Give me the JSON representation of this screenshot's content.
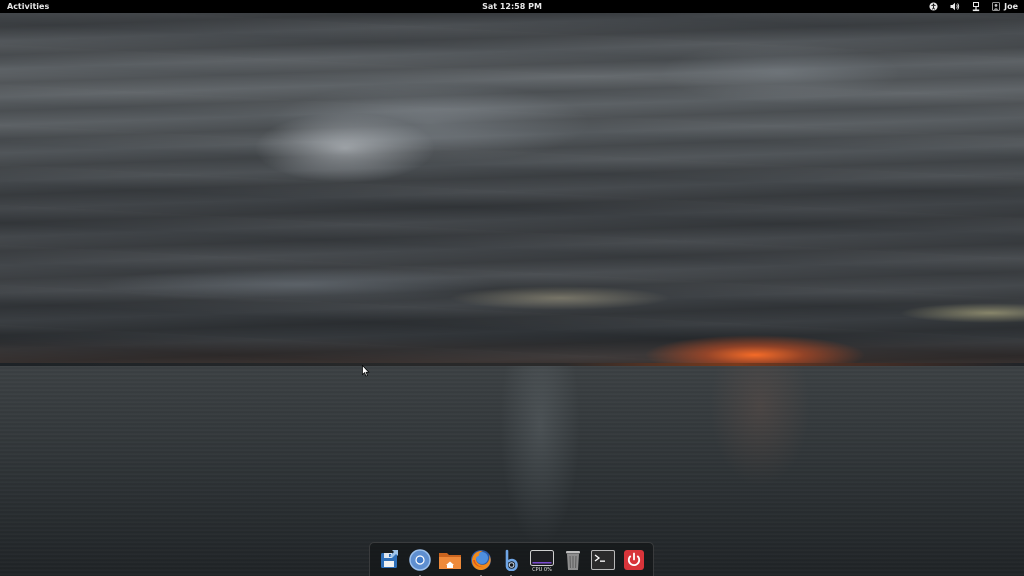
{
  "topbar": {
    "activities_label": "Activities",
    "clock": "Sat 12:58 PM",
    "user_name": "Joe",
    "tray_icons": [
      "accessibility-icon",
      "volume-icon",
      "network-icon",
      "user-icon"
    ]
  },
  "dock": {
    "items": [
      {
        "name": "save-manager",
        "icon": "floppy-save-icon",
        "running": false
      },
      {
        "name": "chromium",
        "icon": "chromium-icon",
        "running": true
      },
      {
        "name": "files",
        "icon": "home-folder-icon",
        "running": false
      },
      {
        "name": "firefox",
        "icon": "firefox-icon",
        "running": true
      },
      {
        "name": "b-app",
        "icon": "blue-b-icon",
        "running": true
      },
      {
        "name": "system-monitor",
        "icon": "cpu-monitor-icon",
        "running": false,
        "label": "CPU 0%"
      },
      {
        "name": "trash",
        "icon": "trash-icon",
        "running": false
      },
      {
        "name": "terminal",
        "icon": "terminal-icon",
        "running": false
      },
      {
        "name": "shutdown",
        "icon": "power-icon",
        "running": false
      }
    ]
  },
  "colors": {
    "topbar_bg": "#000000",
    "topbar_text": "#e8e8e8",
    "sunset_accent": "#ff6e28",
    "power_red": "#d8343a"
  }
}
